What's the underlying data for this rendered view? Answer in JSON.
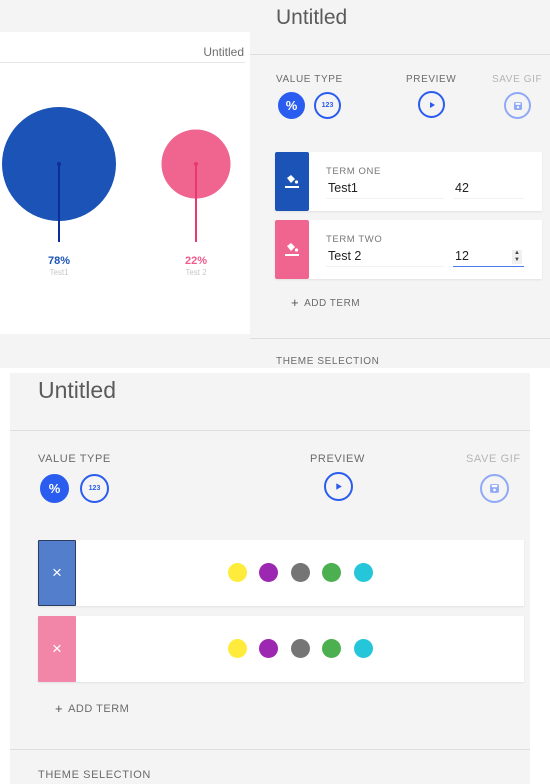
{
  "top_screen": {
    "chart_preview": {
      "title": "Untitled",
      "chart_data": {
        "type": "bubble",
        "title": "Untitled",
        "items": [
          {
            "label": "Test1",
            "percent_label": "78%",
            "value": 78,
            "color": "#1b53b7",
            "stem_color": "#0d2e9a",
            "percent_color": "#1b53b7"
          },
          {
            "label": "Test 2",
            "percent_label": "22%",
            "value": 22,
            "color": "#f06490",
            "stem_color": "#e8386e",
            "percent_color": "#ef5d8d"
          }
        ]
      }
    },
    "panel": {
      "title": "Untitled",
      "value_type_label": "VALUE TYPE",
      "percent_button": "%",
      "number_button": "123",
      "preview_label": "PREVIEW",
      "save_gif_label": "SAVE GIF",
      "terms": [
        {
          "label": "TERM ONE",
          "name": "Test1",
          "value": "42",
          "color": "#1b53b7"
        },
        {
          "label": "TERM TWO",
          "name": "Test 2",
          "value": "12",
          "color": "#f06490"
        }
      ],
      "add_term_label": "ADD TERM",
      "theme_selection_label": "THEME SELECTION"
    }
  },
  "bottom_screen": {
    "panel": {
      "title": "Untitled",
      "value_type_label": "VALUE TYPE",
      "percent_button": "%",
      "number_button": "123",
      "preview_label": "PREVIEW",
      "save_gif_label": "SAVE GIF",
      "term_theme_rows": [
        {
          "swatch_color": "#527ecb",
          "close_icon": "×",
          "palette": [
            "#ffeb3b",
            "#9c27b0",
            "#757575",
            "#4caf50",
            "#26c6da"
          ]
        },
        {
          "swatch_color": "#f286a8",
          "close_icon": "×",
          "palette": [
            "#ffeb3b",
            "#9c27b0",
            "#757575",
            "#4caf50",
            "#26c6da"
          ]
        }
      ],
      "add_term_label": "ADD TERM",
      "theme_selection_label": "THEME SELECTION"
    }
  },
  "colors": {
    "accent": "#2a5cf0",
    "accent_disabled": "#8fa9f6",
    "panel_bg": "#f4f4f4"
  }
}
